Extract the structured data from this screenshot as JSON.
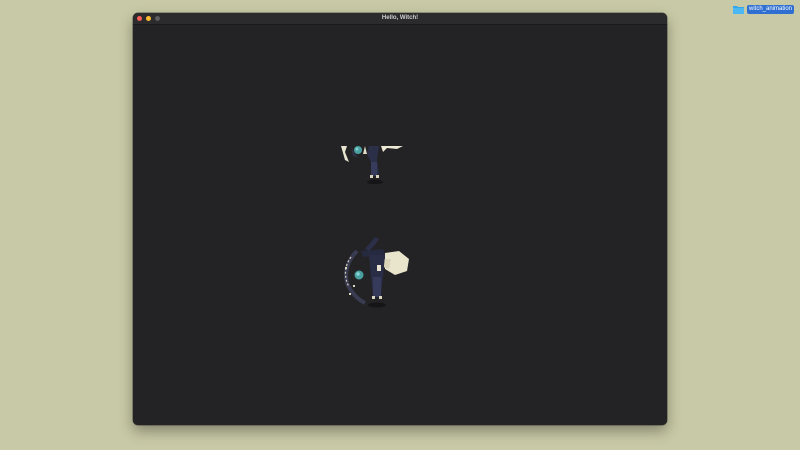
{
  "desktop": {
    "folder": {
      "label": "witch_animation",
      "icon": "folder-icon",
      "color": "#35a7e8"
    }
  },
  "window": {
    "title": "Hello, Witch!",
    "controls": {
      "close_color": "#ff5f57",
      "minimize_color": "#febc2e",
      "maximize_color": "#5c5c5c"
    },
    "background": "#232225"
  },
  "sprites": [
    {
      "name": "witch-sprite-cropped",
      "icon": "witch-sprite-icon"
    },
    {
      "name": "witch-sprite-full",
      "icon": "witch-sprite-icon"
    }
  ]
}
